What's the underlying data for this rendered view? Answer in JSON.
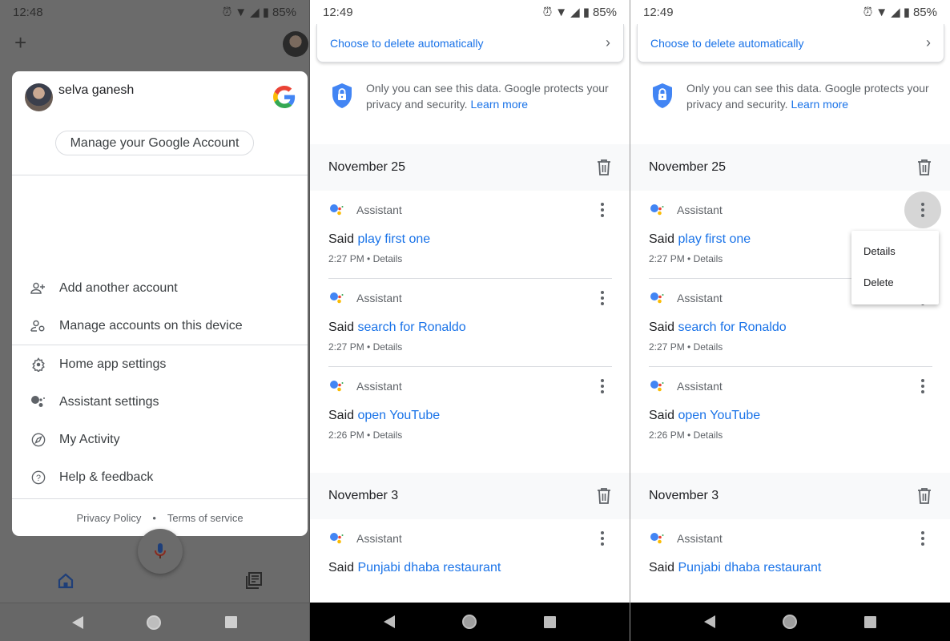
{
  "panel1": {
    "status": {
      "time": "12:48",
      "battery": "85%"
    },
    "account": {
      "name": "selva ganesh",
      "manage_label": "Manage your Google Account"
    },
    "menu": [
      {
        "icon": "add-person-icon",
        "label": "Add another account"
      },
      {
        "icon": "manage-accounts-icon",
        "label": "Manage accounts on this device"
      },
      {
        "icon": "gear-icon",
        "label": "Home app settings"
      },
      {
        "icon": "assistant-icon",
        "label": "Assistant settings"
      },
      {
        "icon": "compass-icon",
        "label": "My Activity"
      },
      {
        "icon": "help-icon",
        "label": "Help & feedback"
      }
    ],
    "footer": {
      "privacy": "Privacy Policy",
      "separator": "•",
      "terms": "Terms of service"
    }
  },
  "activity": {
    "status": {
      "time": "12:49",
      "battery": "85%"
    },
    "auto_delete_label": "Choose to delete automatically",
    "privacy_text": "Only you can see this data. Google protects your privacy and security.",
    "learn_more": "Learn more",
    "days": [
      {
        "label": "November 25",
        "entries": [
          {
            "source": "Assistant",
            "said": "Said",
            "query": "play first one",
            "time": "2:27 PM",
            "details": "Details"
          },
          {
            "source": "Assistant",
            "said": "Said",
            "query": "search for Ronaldo",
            "time": "2:27 PM",
            "details": "Details"
          },
          {
            "source": "Assistant",
            "said": "Said",
            "query": "open YouTube",
            "time": "2:26 PM",
            "details": "Details"
          }
        ]
      },
      {
        "label": "November 3",
        "entries": [
          {
            "source": "Assistant",
            "said": "Said",
            "query": "Punjabi dhaba restaurant"
          }
        ]
      }
    ],
    "context_menu": [
      "Details",
      "Delete"
    ]
  },
  "colors": {
    "accent": "#1a73e8",
    "text": "#202124",
    "secondary": "#5f6368"
  }
}
